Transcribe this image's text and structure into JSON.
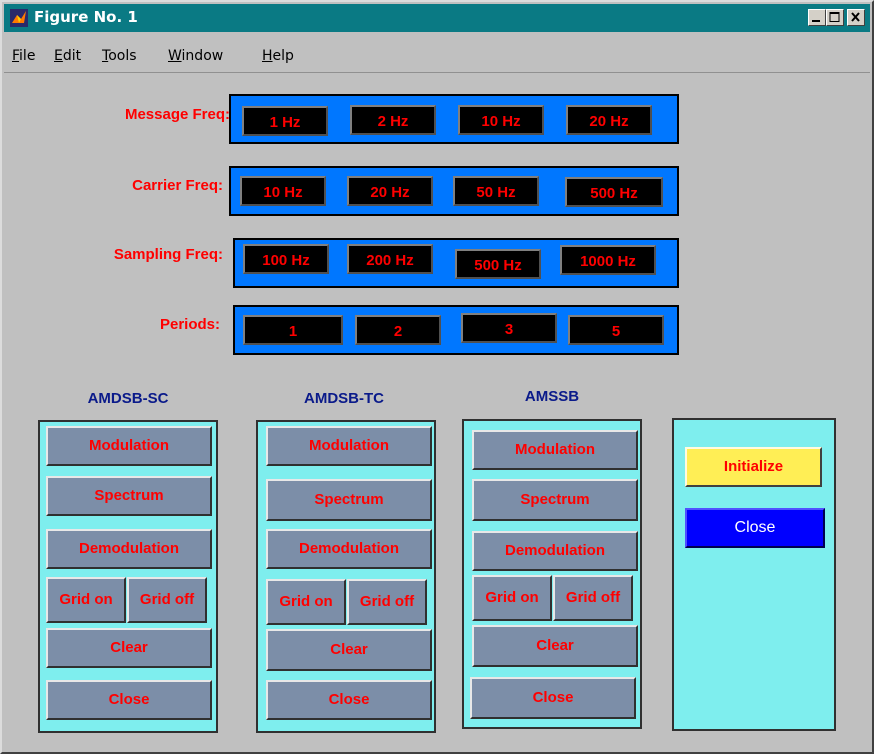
{
  "window": {
    "title": "Figure No. 1"
  },
  "menu": {
    "items": [
      {
        "first": "F",
        "rest": "ile"
      },
      {
        "first": "E",
        "rest": "dit"
      },
      {
        "first": "T",
        "rest": "ools"
      },
      {
        "first": "W",
        "rest": "indow"
      },
      {
        "first": "H",
        "rest": "elp"
      }
    ]
  },
  "rows": [
    {
      "label": "Message Freq:",
      "buttons": [
        "1 Hz",
        "2 Hz",
        "10  Hz",
        "20  Hz"
      ]
    },
    {
      "label": "Carrier Freq:",
      "buttons": [
        "10 Hz",
        "20 Hz",
        "50 Hz",
        "500 Hz"
      ]
    },
    {
      "label": "Sampling Freq:",
      "buttons": [
        "100 Hz",
        "200 Hz",
        "500 Hz",
        "1000 Hz"
      ]
    },
    {
      "label": "Periods:",
      "buttons": [
        "1",
        "2",
        "3",
        "5"
      ]
    }
  ],
  "groups": [
    {
      "title": "AMDSB-SC"
    },
    {
      "title": "AMDSB-TC"
    },
    {
      "title": "AMSSB"
    }
  ],
  "group_buttons": {
    "modulation": "Modulation",
    "spectrum": "Spectrum",
    "demodulation": "Demodulation",
    "grid_on": "Grid on",
    "grid_off": "Grid off",
    "clear": "Clear",
    "close": "Close"
  },
  "control": {
    "initialize": "Initialize",
    "close": "Close"
  },
  "colors": {
    "title_bar": "#0a7a84",
    "panel_blue": "#0077ff",
    "panel_cyan": "#7eeeee",
    "label_red": "#ff0000",
    "group_title": "#0a1a8a"
  }
}
